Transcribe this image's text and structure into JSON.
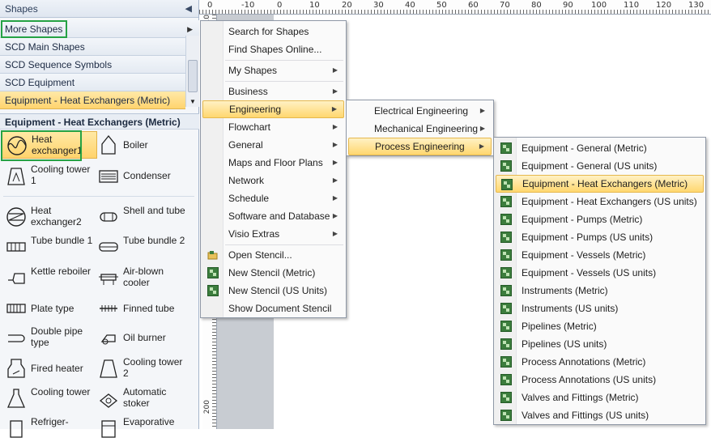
{
  "pane": {
    "title": "Shapes",
    "more_shapes": "More Shapes",
    "stencils": [
      "SCD Main Shapes",
      "SCD Sequence Symbols",
      "SCD Equipment",
      "Equipment - Heat Exchangers (Metric)"
    ],
    "section_title": "Equipment - Heat Exchangers (Metric)",
    "shapes": [
      {
        "label": "Heat exchanger1",
        "icon": "heat-exchanger-icon"
      },
      {
        "label": "Boiler",
        "icon": "boiler-icon"
      },
      {
        "label": "Cooling tower 1",
        "icon": "cooling-tower-icon"
      },
      {
        "label": "Condenser",
        "icon": "condenser-icon"
      },
      {
        "label": "Heat exchanger2",
        "icon": "heat-exchanger-icon"
      },
      {
        "label": "Shell and tube",
        "icon": "shell-tube-icon"
      },
      {
        "label": "Tube bundle 1",
        "icon": "tube-bundle-icon"
      },
      {
        "label": "Tube bundle 2",
        "icon": "tube-bundle-icon"
      },
      {
        "label": "Kettle reboiler",
        "icon": "kettle-reboiler-icon"
      },
      {
        "label": "Air-blown cooler",
        "icon": "air-cooler-icon"
      },
      {
        "label": "Plate type",
        "icon": "plate-type-icon"
      },
      {
        "label": "Finned tube",
        "icon": "finned-tube-icon"
      },
      {
        "label": "Double pipe type",
        "icon": "double-pipe-icon"
      },
      {
        "label": "Oil burner",
        "icon": "oil-burner-icon"
      },
      {
        "label": "Fired heater",
        "icon": "fired-heater-icon"
      },
      {
        "label": "Cooling tower 2",
        "icon": "cooling-tower-icon"
      },
      {
        "label": "Cooling tower",
        "icon": "cooling-tower-icon"
      },
      {
        "label": "Automatic stoker",
        "icon": "stoker-icon"
      },
      {
        "label": "Refriger-",
        "icon": "refrigerator-icon"
      },
      {
        "label": "Evaporative",
        "icon": "evaporative-icon"
      }
    ]
  },
  "ruler": {
    "top": [
      "0",
      "-10",
      "0",
      "10",
      "20",
      "30",
      "40",
      "50",
      "60",
      "70",
      "80",
      "90",
      "100",
      "110",
      "120",
      "130"
    ],
    "left": [
      "10",
      "200"
    ]
  },
  "menu1": {
    "search": "Search for Shapes",
    "find_online": "Find Shapes Online...",
    "my_shapes": "My Shapes",
    "categories": [
      "Business",
      "Engineering",
      "Flowchart",
      "General",
      "Maps and Floor Plans",
      "Network",
      "Schedule",
      "Software and Database",
      "Visio Extras"
    ],
    "open_stencil": "Open Stencil...",
    "new_metric": "New Stencil (Metric)",
    "new_us": "New Stencil (US Units)",
    "show_doc": "Show Document Stencil"
  },
  "menu2": {
    "items": [
      "Electrical Engineering",
      "Mechanical Engineering",
      "Process Engineering"
    ]
  },
  "menu3": {
    "items": [
      "Equipment - General (Metric)",
      "Equipment - General (US units)",
      "Equipment - Heat Exchangers (Metric)",
      "Equipment - Heat Exchangers (US units)",
      "Equipment - Pumps (Metric)",
      "Equipment - Pumps (US units)",
      "Equipment - Vessels (Metric)",
      "Equipment - Vessels (US units)",
      "Instruments (Metric)",
      "Instruments (US units)",
      "Pipelines (Metric)",
      "Pipelines (US units)",
      "Process Annotations (Metric)",
      "Process Annotations (US units)",
      "Valves and Fittings (Metric)",
      "Valves and Fittings (US units)"
    ]
  }
}
